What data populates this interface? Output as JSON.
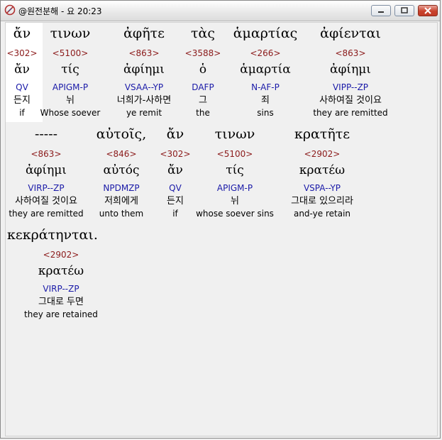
{
  "window": {
    "title": "@원전분해 - 요 20:23"
  },
  "rows": [
    {
      "words": [
        {
          "greek": "ἄν",
          "strong": "<302>",
          "lemma": "ἄν",
          "parse": "QV",
          "korean": "든지",
          "english": "if"
        },
        {
          "greek": "τινων",
          "strong": "<5100>",
          "lemma": "τίς",
          "parse": "APIGM-P",
          "korean": "뉘",
          "english": "Whose soever"
        },
        {
          "greek": "ἀφῆτε",
          "strong": "<863>",
          "lemma": "ἀφίημι",
          "parse": "VSAA--YP",
          "korean": "너희가-사하면",
          "english": "ye remit"
        },
        {
          "greek": "τὰς",
          "strong": "<3588>",
          "lemma": "ὁ",
          "parse": "DAFP",
          "korean": "그",
          "english": "the"
        },
        {
          "greek": "ἁμαρτίας",
          "strong": "<266>",
          "lemma": "ἁμαρτία",
          "parse": "N-AF-P",
          "korean": "죄",
          "english": "sins"
        },
        {
          "greek": "ἀφίενται",
          "strong": "<863>",
          "lemma": "ἀφίημι",
          "parse": "VIPP--ZP",
          "korean": "사하여질 것이요",
          "english": "they are remitted"
        }
      ]
    },
    {
      "words": [
        {
          "greek": "-----",
          "strong": "<863>",
          "lemma": "ἀφίημι",
          "parse": "VIRP--ZP",
          "korean": "사하여질 것이요",
          "english": "they are remitted"
        },
        {
          "greek": "αὐτοῖς,",
          "strong": "<846>",
          "lemma": "αὐτός",
          "parse": "NPDMZP",
          "korean": "저희에게",
          "english": "unto them"
        },
        {
          "greek": "ἄν",
          "strong": "<302>",
          "lemma": "ἄν",
          "parse": "QV",
          "korean": "든지",
          "english": "if"
        },
        {
          "greek": "τινων",
          "strong": "<5100>",
          "lemma": "τίς",
          "parse": "APIGM-P",
          "korean": "뉘",
          "english": "whose soever sins"
        },
        {
          "greek": "κρατῆτε",
          "strong": "<2902>",
          "lemma": "κρατέω",
          "parse": "VSPA--YP",
          "korean": "그대로 있으리라",
          "english": "and-ye retain"
        }
      ]
    },
    {
      "words": [
        {
          "greek": "κεκράτηνται.",
          "strong": "<2902>",
          "lemma": "κρατέω",
          "parse": "VIRP--ZP",
          "korean": "그대로 두면",
          "english": "they are retained"
        }
      ]
    }
  ],
  "colors": {
    "strong": "#8b1a1a",
    "parse": "#1a1aa8"
  },
  "icons": {
    "app": "app-logo-icon",
    "minimize": "minimize-icon",
    "maximize": "maximize-icon",
    "close": "close-icon"
  }
}
